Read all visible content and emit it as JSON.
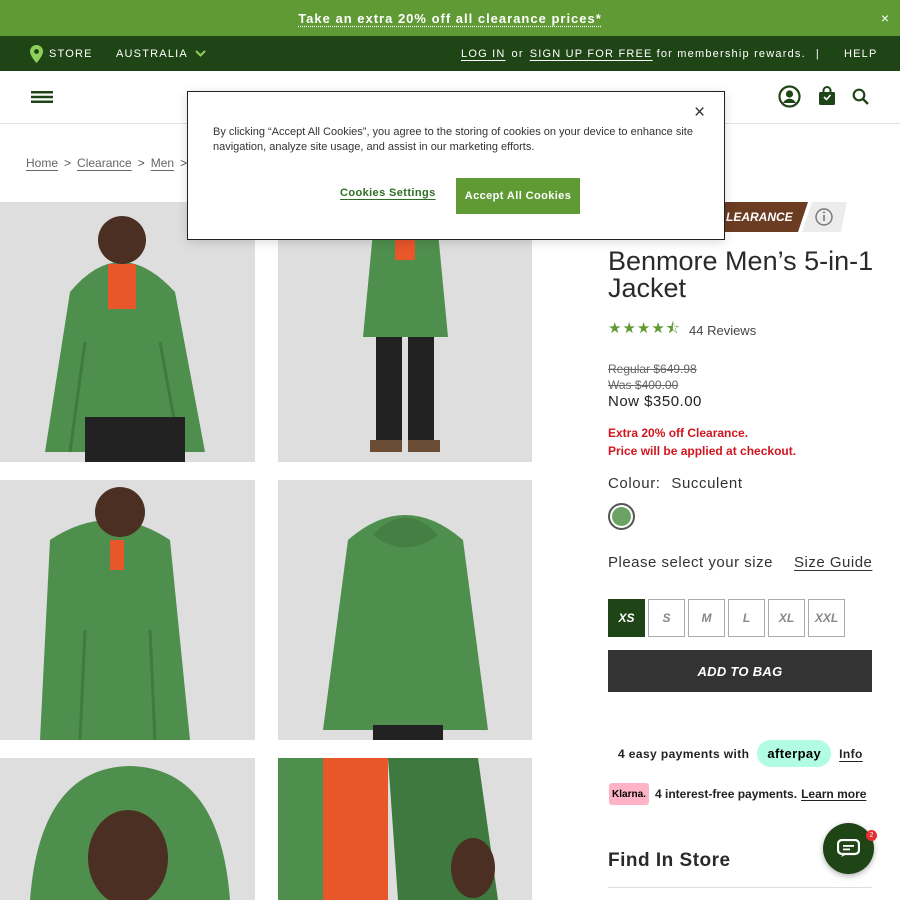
{
  "promo": {
    "text": "Take an extra 20% off all clearance prices*",
    "close": "×"
  },
  "topbar": {
    "store": "STORE",
    "region": "AUSTRALIA",
    "login": "LOG IN",
    "or": "or",
    "signup": "SIGN UP FOR FREE",
    "rewards": "for membership rewards.",
    "divider": "|",
    "help": "HELP"
  },
  "breadcrumb": [
    "Home",
    "Clearance",
    "Men"
  ],
  "product": {
    "badge": "LEARANCE",
    "title": "Benmore Men’s 5-in-1 Jacket",
    "rating": 4.5,
    "stars": "★★★★⯪",
    "reviews": "44 Reviews",
    "regular": "Regular $649.98",
    "was": "Was $400.00",
    "now": "Now $350.00",
    "extra": "Extra 20% off Clearance.",
    "extra2": "Price will be applied at checkout.",
    "colour_label": "Colour:",
    "colour_value": "Succulent",
    "colour_hex": "#6aa363",
    "size_prompt": "Please select your size",
    "size_guide": "Size Guide",
    "sizes": [
      "XS",
      "S",
      "M",
      "L",
      "XL",
      "XXL"
    ],
    "selected_size": "XS",
    "add_to_bag": "ADD TO BAG"
  },
  "payments": {
    "afterpay_text": "4 easy payments with",
    "afterpay_logo": "afterpay",
    "afterpay_info": "Info",
    "klarna_logo": "Klarna.",
    "klarna_text": "4 interest-free payments.",
    "klarna_link": "Learn more"
  },
  "find_in_store": "Find In Store",
  "chat_badge": "2",
  "cookie": {
    "text": "By clicking “Accept All Cookies”, you agree to the storing of cookies on your device to enhance site navigation, analyze site usage, and assist in our marketing efforts.",
    "close": "×",
    "settings": "Cookies Settings",
    "accept": "Accept All Cookies"
  },
  "colors": {
    "brand_green": "#5f9a34",
    "dark_green": "#1f4517",
    "sale_red": "#d0161e",
    "jacket": "#4f8f4e",
    "shirt": "#e8572a"
  }
}
